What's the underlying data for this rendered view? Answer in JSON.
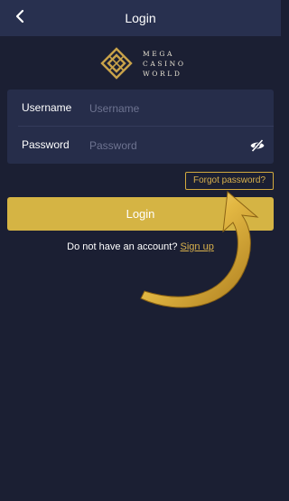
{
  "header": {
    "title": "Login",
    "back_icon": "chevron-left-icon"
  },
  "brand": {
    "line1": "MEGA",
    "line2": "CASINO",
    "line3": "WORLD",
    "logo_icon": "mega-casino-world-logo",
    "logo_color": "#c8a24a"
  },
  "form": {
    "username_label": "Username",
    "username_placeholder": "Username",
    "username_value": "",
    "password_label": "Password",
    "password_placeholder": "Password",
    "password_value": "",
    "password_toggle_icon": "eye-off-icon"
  },
  "forgot_password_label": "Forgot password?",
  "login_button_label": "Login",
  "signup": {
    "prompt": "Do not have an account?",
    "link_label": "Sign up"
  },
  "annotation": {
    "icon": "curved-arrow-icon",
    "color": "#e0b53c"
  },
  "colors": {
    "background": "#1b1f33",
    "header": "#28304f",
    "card": "#262d4a",
    "accent": "#d5b444"
  }
}
